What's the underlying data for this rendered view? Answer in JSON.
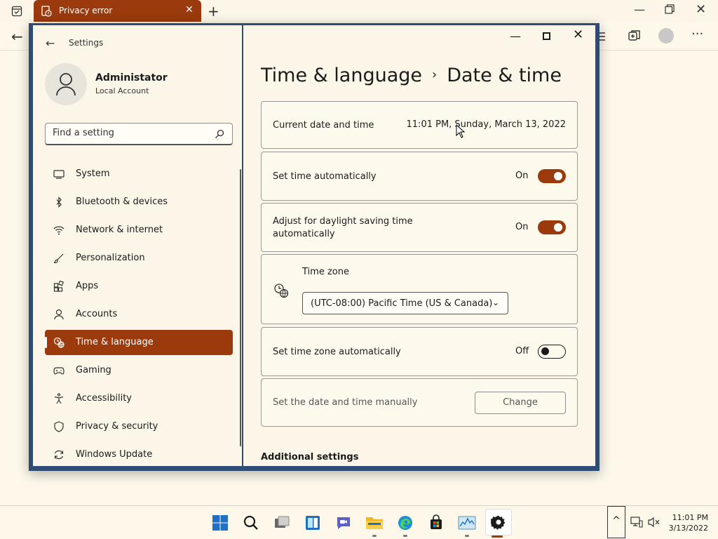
{
  "browser": {
    "tab_title": "Privacy error",
    "tab_close": "✕",
    "new_tab": "+",
    "min": "—",
    "close": "✕",
    "back": "←",
    "more": "···"
  },
  "settings": {
    "app_title": "Settings",
    "back": "←",
    "user": {
      "name": "Administator",
      "type": "Local Account"
    },
    "search": {
      "placeholder": "Find a setting"
    },
    "nav": [
      {
        "label": "System",
        "icon": "system-icon"
      },
      {
        "label": "Bluetooth & devices",
        "icon": "bluetooth-icon"
      },
      {
        "label": "Network & internet",
        "icon": "wifi-icon"
      },
      {
        "label": "Personalization",
        "icon": "brush-icon"
      },
      {
        "label": "Apps",
        "icon": "apps-icon"
      },
      {
        "label": "Accounts",
        "icon": "person-icon"
      },
      {
        "label": "Time & language",
        "icon": "globe-clock-icon",
        "active": true
      },
      {
        "label": "Gaming",
        "icon": "gamepad-icon"
      },
      {
        "label": "Accessibility",
        "icon": "accessibility-icon"
      },
      {
        "label": "Privacy & security",
        "icon": "shield-icon"
      },
      {
        "label": "Windows Update",
        "icon": "update-icon"
      }
    ],
    "window": {
      "min": "—",
      "close": "✕"
    },
    "breadcrumb": {
      "parent": "Time & language",
      "sep": "›",
      "current": "Date & time"
    },
    "rows": {
      "current": {
        "label": "Current date and time",
        "value": "11:01 PM, Sunday, March 13, 2022"
      },
      "auto_time": {
        "label": "Set time automatically",
        "state": "On"
      },
      "dst": {
        "label_line1": "Adjust for daylight saving time",
        "label_line2": "automatically",
        "state": "On"
      },
      "timezone": {
        "label": "Time zone",
        "value": "(UTC-08:00) Pacific Time (US & Canada)",
        "chevron": "⌄"
      },
      "auto_tz": {
        "label": "Set time zone automatically",
        "state": "Off"
      },
      "manual": {
        "label": "Set the date and time manually",
        "button": "Change"
      }
    },
    "additional_heading": "Additional settings"
  },
  "taskbar": {
    "tray_chevron": "^",
    "clock_time": "11:01 PM",
    "clock_date": "3/13/2022"
  },
  "colors": {
    "accent": "#9a3a0d",
    "window_border": "#2f4d74",
    "background": "#fbf6e7"
  }
}
